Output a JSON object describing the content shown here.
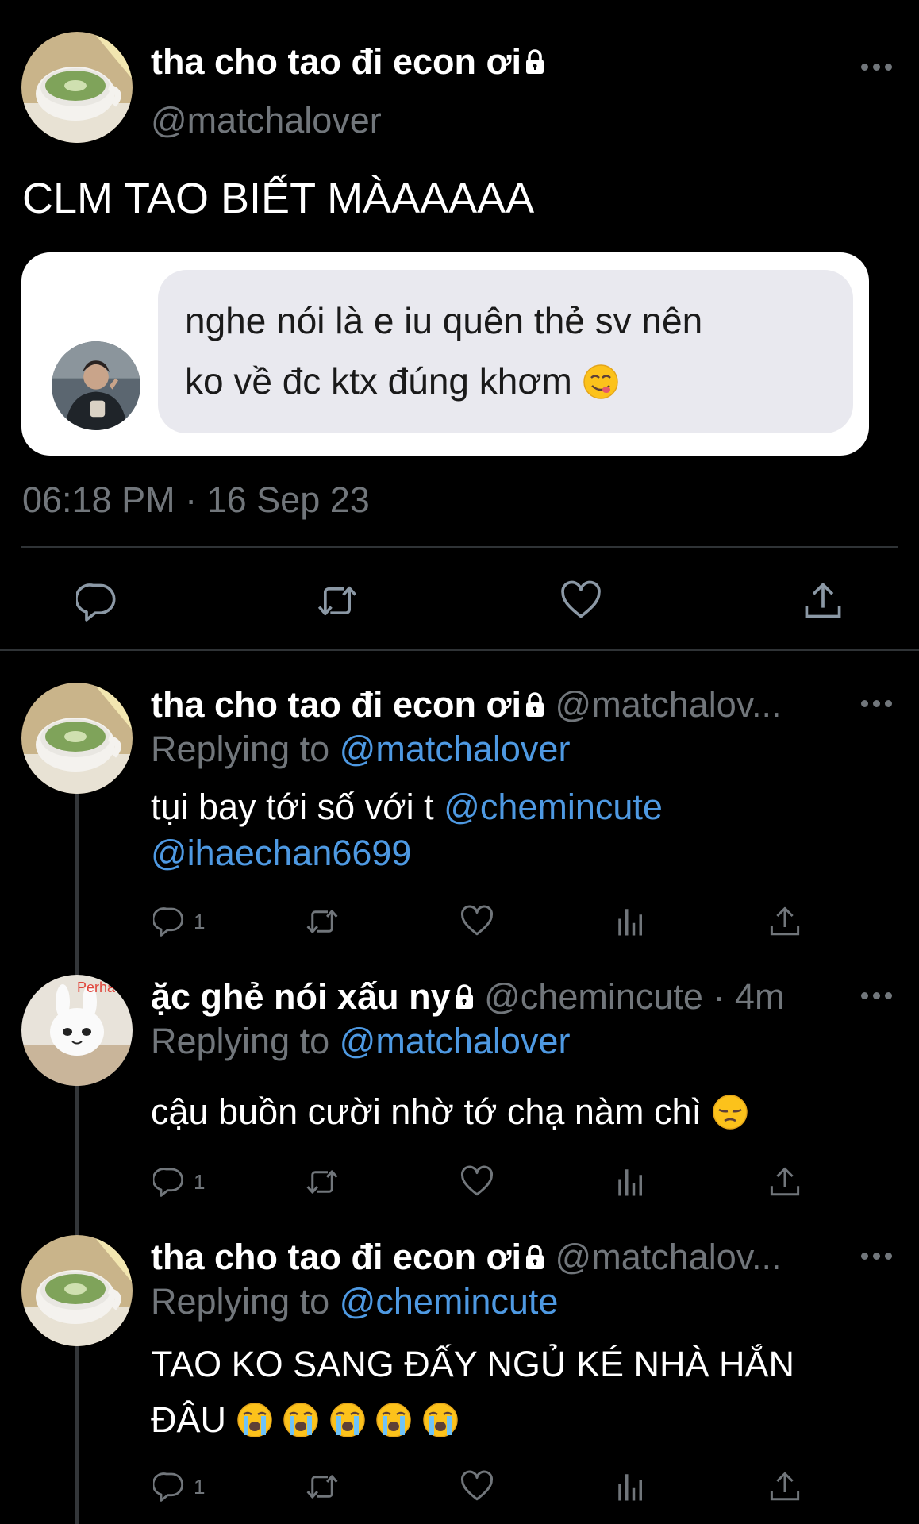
{
  "colors": {
    "background": "#000000",
    "mention": "#4e99e2",
    "muted": "#71767b",
    "divider": "#2f3336"
  },
  "main_tweet": {
    "display_name": "tha cho tao đi econ ơi",
    "handle": "@matchalover",
    "text": "CLM TAO BIẾT MÀAAAAA",
    "quote": {
      "line1": "nghe nói là e iu quên thẻ sv nên",
      "line2": "ko về đc ktx đúng khơm",
      "emoji": "yum-face-emoji"
    },
    "timestamp": "06:18 PM · 16 Sep 23",
    "actions": [
      "reply-icon",
      "retweet-icon",
      "like-icon",
      "share-icon"
    ]
  },
  "replies": [
    {
      "display_name": "tha cho tao đi econ ơi",
      "handle": "@matchalov...",
      "replying_label": "Replying to",
      "replying_to": "@matchalover",
      "text_plain": "tụi bay tới số với t",
      "mention1": "@chemincute",
      "mention2": "@ihaechan6699",
      "reply_count": "1"
    },
    {
      "display_name": "ặc ghẻ nói xấu ny",
      "handle": "@chemincute · 4m",
      "replying_label": "Replying to",
      "replying_to": "@matchalover",
      "text_plain": "cậu buồn cười nhờ tớ chạ nàm chì",
      "emoji": "pensive-face-emoji",
      "avatar_text": "Perha",
      "reply_count": "1"
    },
    {
      "display_name": "tha cho tao đi econ ơi",
      "handle": "@matchalov...",
      "replying_label": "Replying to",
      "replying_to": "@chemincute",
      "line1": "TAO KO SANG ĐẤY NGỦ KÉ NHÀ HẮN",
      "line2": "ĐÂU",
      "emojis": [
        "crying-face-emoji",
        "crying-face-emoji",
        "crying-face-emoji",
        "crying-face-emoji",
        "crying-face-emoji"
      ],
      "reply_count": "1"
    }
  ]
}
